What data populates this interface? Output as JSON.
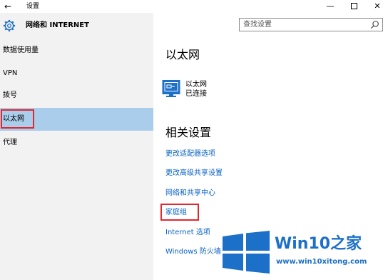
{
  "titlebar": {
    "back": "←",
    "title": "设置",
    "minimize": "—",
    "close": "✕"
  },
  "header": {
    "app_title": "网络和 INTERNET"
  },
  "search": {
    "placeholder": "查找设置"
  },
  "sidebar": {
    "items": [
      {
        "label": "数据使用量"
      },
      {
        "label": "VPN"
      },
      {
        "label": "拨号"
      },
      {
        "label": "以太网",
        "selected": true
      },
      {
        "label": "代理"
      }
    ]
  },
  "main": {
    "heading": "以太网",
    "ethernet": {
      "name": "以太网",
      "status": "已连接",
      "icon": "ethernet-monitor-icon"
    },
    "related_heading": "相关设置",
    "links": [
      {
        "label": "更改适配器选项"
      },
      {
        "label": "更改高级共享设置"
      },
      {
        "label": "网络和共享中心"
      },
      {
        "label": "家庭组"
      },
      {
        "label": "Internet 选项"
      },
      {
        "label": "Windows 防火墙"
      }
    ]
  },
  "watermark": {
    "title_prefix": "Win10",
    "title_suffix": "之家",
    "url": "www.win10xitong.com"
  },
  "colors": {
    "accent": "#1d70c8",
    "link": "#0a63c4",
    "selected_bg": "#a9cdea",
    "highlight_box": "#e0282e",
    "sidebar_bg": "#f2f2f2"
  }
}
